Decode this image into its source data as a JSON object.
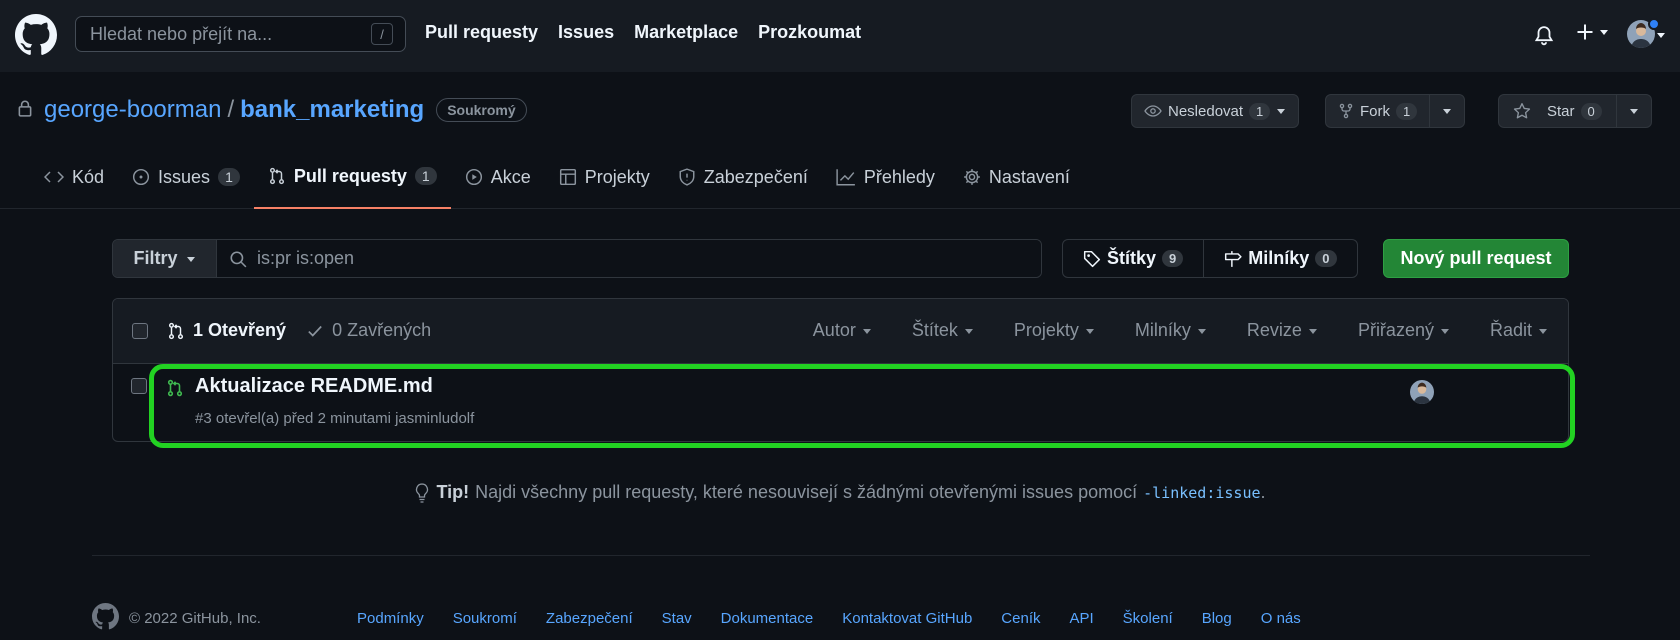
{
  "header": {
    "search_placeholder": "Hledat nebo přejít na...",
    "search_shortcut": "/",
    "nav": [
      "Pull requesty",
      "Issues",
      "Marketplace",
      "Prozkoumat"
    ]
  },
  "repo": {
    "owner": "george-boorman",
    "separator": "/",
    "name": "bank_marketing",
    "visibility": "Soukromý",
    "watch": {
      "label": "Nesledovat",
      "count": "1"
    },
    "fork": {
      "label": "Fork",
      "count": "1"
    },
    "star": {
      "label": "Star",
      "count": "0"
    }
  },
  "tabs": [
    {
      "label": "Kód",
      "icon": "code-icon"
    },
    {
      "label": "Issues",
      "count": "1",
      "icon": "issue-opened-icon"
    },
    {
      "label": "Pull requesty",
      "count": "1",
      "icon": "git-pull-request-icon",
      "active": true
    },
    {
      "label": "Akce",
      "icon": "play-icon"
    },
    {
      "label": "Projekty",
      "icon": "table-icon"
    },
    {
      "label": "Zabezpečení",
      "icon": "shield-icon"
    },
    {
      "label": "Přehledy",
      "icon": "graph-icon"
    },
    {
      "label": "Nastavení",
      "icon": "gear-icon"
    }
  ],
  "filters": {
    "button": "Filtry",
    "query": "is:pr is:open",
    "labels": {
      "label": "Štítky",
      "count": "9"
    },
    "milestones": {
      "label": "Milníky",
      "count": "0"
    },
    "new_pr": "Nový pull request"
  },
  "list": {
    "open": "1 Otevřený",
    "closed": "0 Zavřených",
    "sorters": [
      "Autor",
      "Štítek",
      "Projekty",
      "Milníky",
      "Revize",
      "Přiřazený",
      "Řadit"
    ],
    "items": [
      {
        "title": "Aktualizace README.md",
        "meta": "#3 otevřel(a) před 2 minutami jasminludolf"
      }
    ]
  },
  "tip": {
    "strong": "Tip!",
    "text": "Najdi všechny pull requesty, které nesouvisejí s žádnými otevřenými issues pomocí",
    "code": "-linked:issue",
    "end": "."
  },
  "footer": {
    "copyright": "© 2022 GitHub, Inc.",
    "links": [
      "Podmínky",
      "Soukromí",
      "Zabezpečení",
      "Stav",
      "Dokumentace",
      "Kontaktovat GitHub",
      "Ceník",
      "API",
      "Školení",
      "Blog",
      "O nás"
    ]
  },
  "colors": {
    "accent": "#58a6ff",
    "primary_button": "#238636",
    "highlight": "#22d222",
    "active_tab": "#f78166",
    "open_icon": "#3fb950"
  }
}
